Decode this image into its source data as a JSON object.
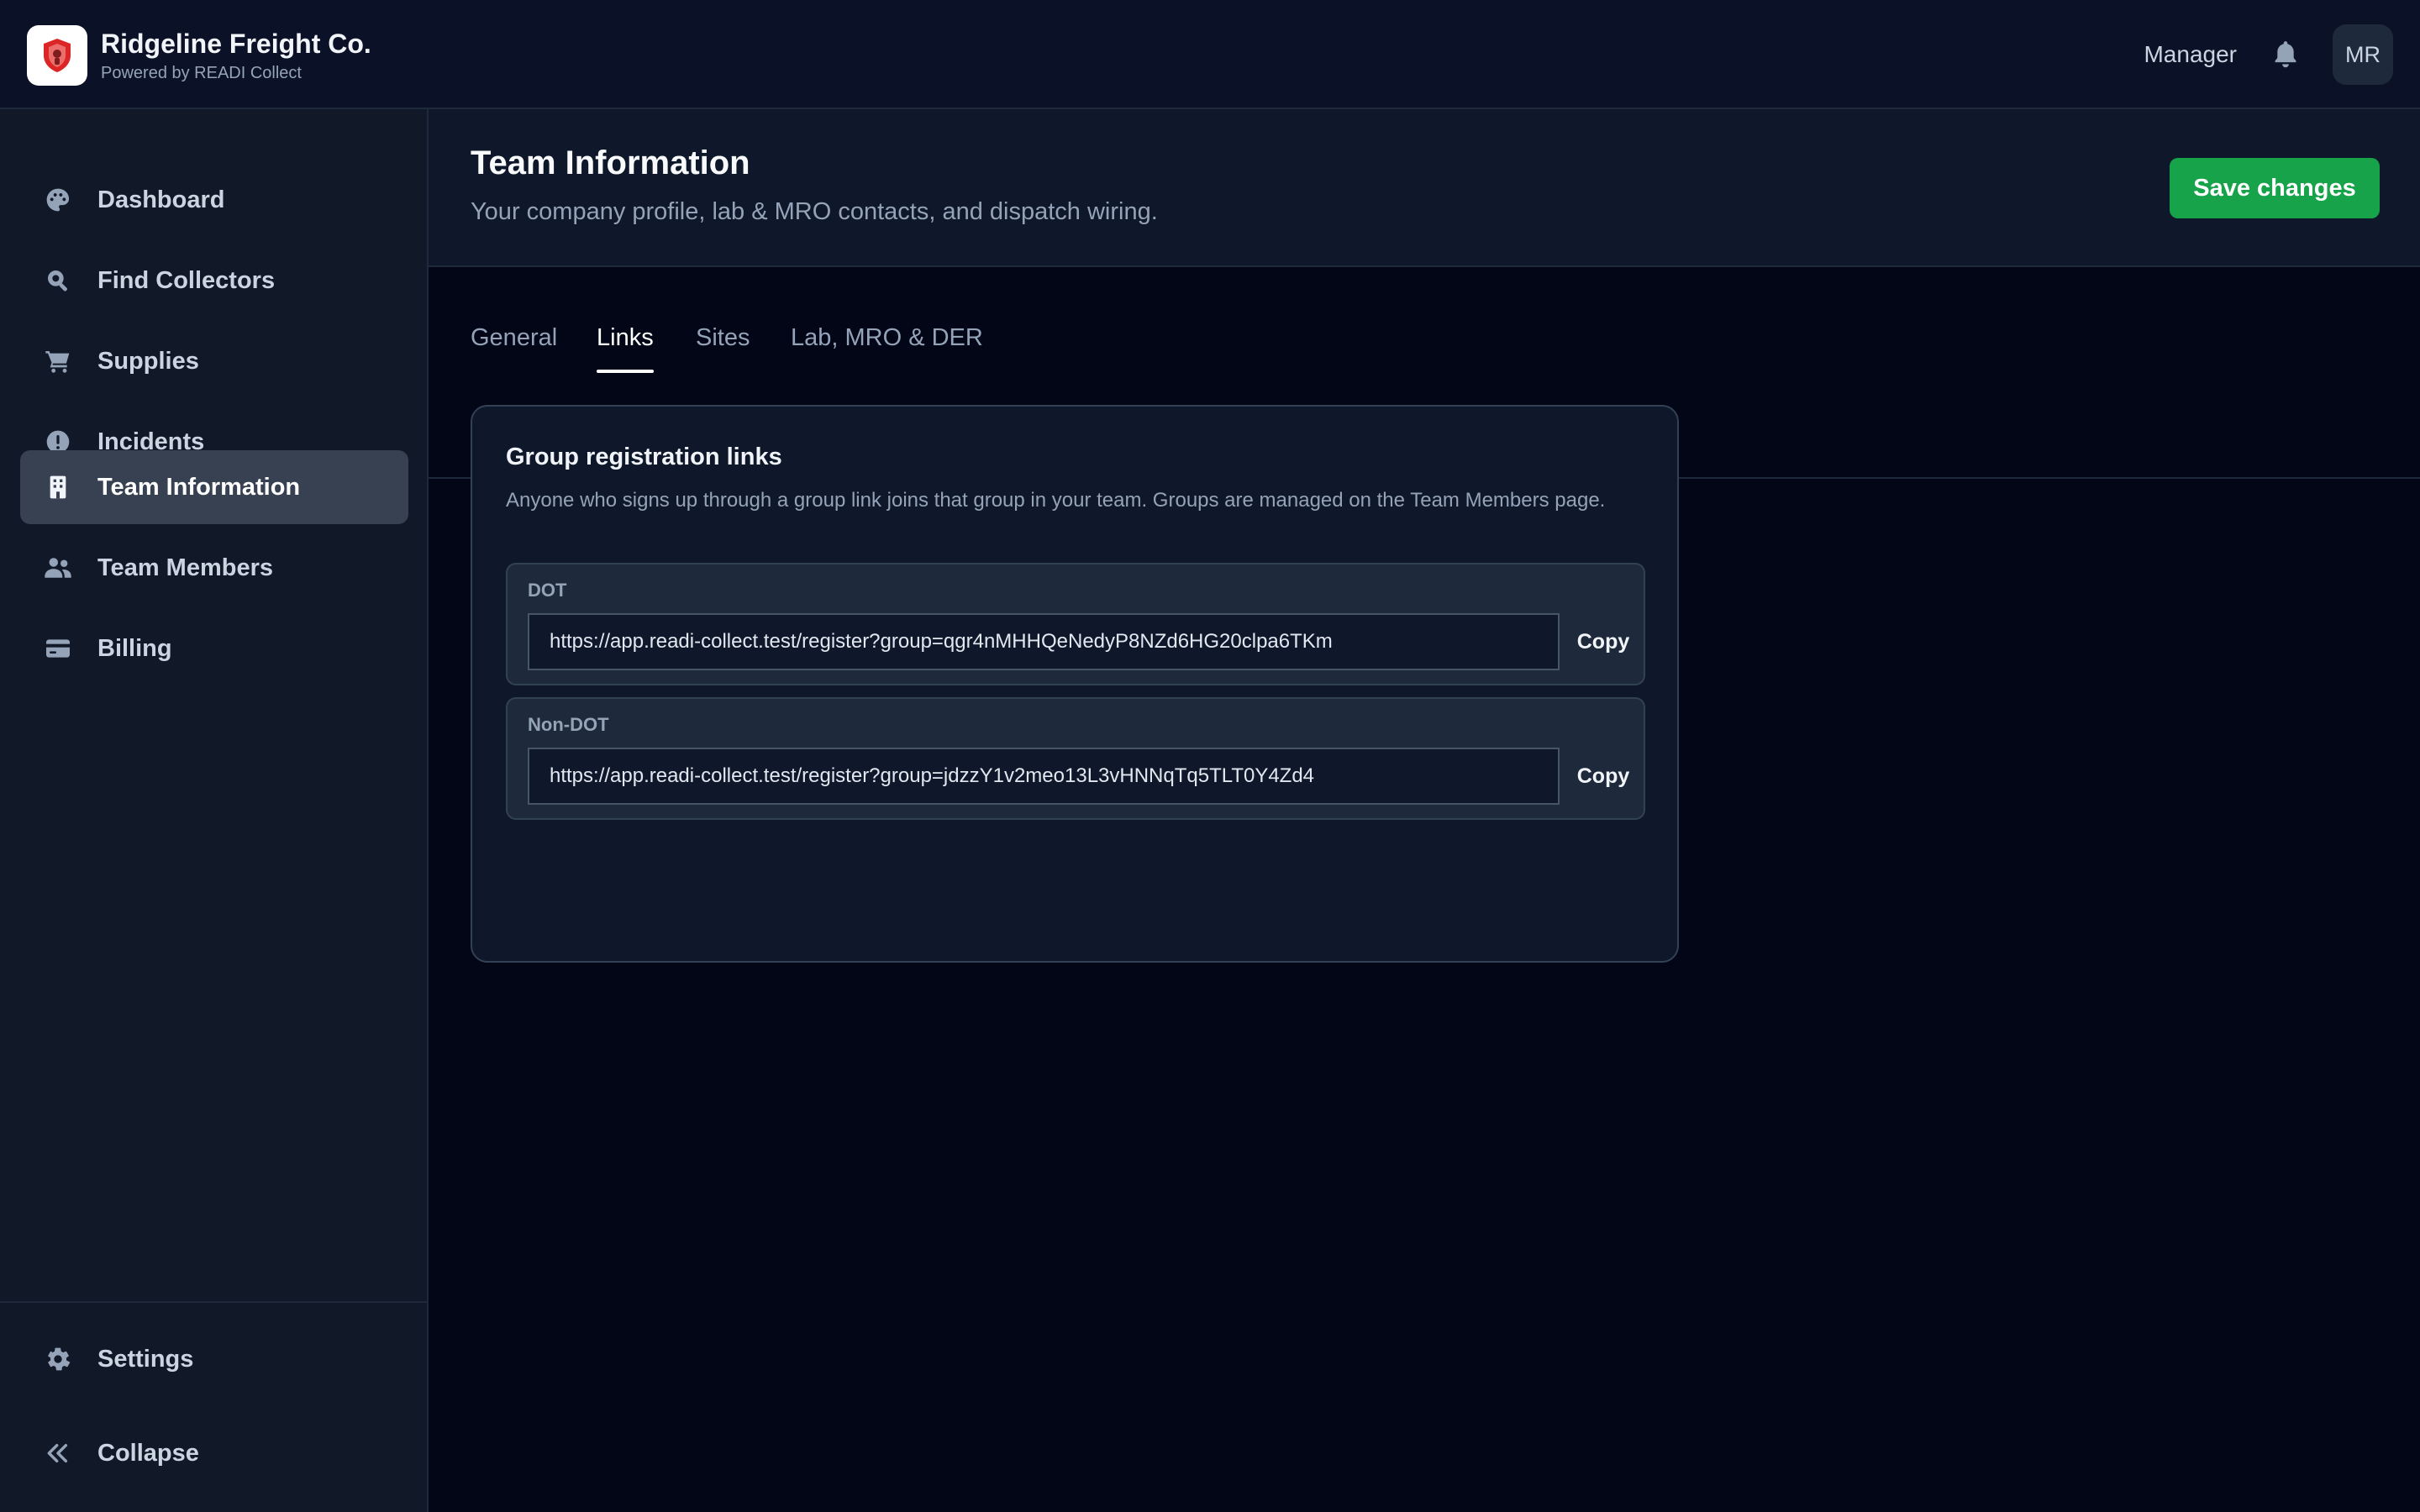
{
  "brand": {
    "name": "Ridgeline Freight Co.",
    "tagline": "Powered by READI Collect",
    "logo_icon": "shield-badge-icon",
    "accent_color": "#dc2626"
  },
  "header": {
    "role": "Manager",
    "notifications_icon": "bell-icon",
    "avatar_initials": "MR"
  },
  "sidebar": {
    "items": [
      {
        "label": "Dashboard",
        "icon": "palette-icon",
        "active": false
      },
      {
        "label": "Find Collectors",
        "icon": "search-icon",
        "active": false
      },
      {
        "label": "Supplies",
        "icon": "cart-icon",
        "active": false
      },
      {
        "label": "Incidents",
        "icon": "alert-circle-icon",
        "active": false
      },
      {
        "label": "Team Information",
        "icon": "building-icon",
        "active": true
      },
      {
        "label": "Team Members",
        "icon": "users-icon",
        "active": false
      },
      {
        "label": "Billing",
        "icon": "credit-card-icon",
        "active": false
      }
    ],
    "footer": {
      "settings_label": "Settings",
      "settings_icon": "gear-icon",
      "collapse_label": "Collapse",
      "collapse_icon": "double-chevron-left-icon"
    }
  },
  "page": {
    "title": "Team Information",
    "subtitle": "Your company profile, lab & MRO contacts, and dispatch wiring.",
    "save_label": "Save changes",
    "save_color": "#16a34a"
  },
  "tabs": [
    {
      "label": "General",
      "active": false
    },
    {
      "label": "Links",
      "active": true
    },
    {
      "label": "Sites",
      "active": false
    },
    {
      "label": "Lab, MRO & DER",
      "active": false
    }
  ],
  "card": {
    "title": "Group registration links",
    "description": "Anyone who signs up through a group link joins that group in your team. Groups are managed on the Team Members page.",
    "links": [
      {
        "label": "DOT",
        "url": "https://app.readi-collect.test/register?group=qgr4nMHHQeNedyP8NZd6HG20clpa6TKm",
        "copy_label": "Copy"
      },
      {
        "label": "Non-DOT",
        "url": "https://app.readi-collect.test/register?group=jdzzY1v2meo13L3vHNNqTq5TLT0Y4Zd4",
        "copy_label": "Copy"
      }
    ]
  }
}
